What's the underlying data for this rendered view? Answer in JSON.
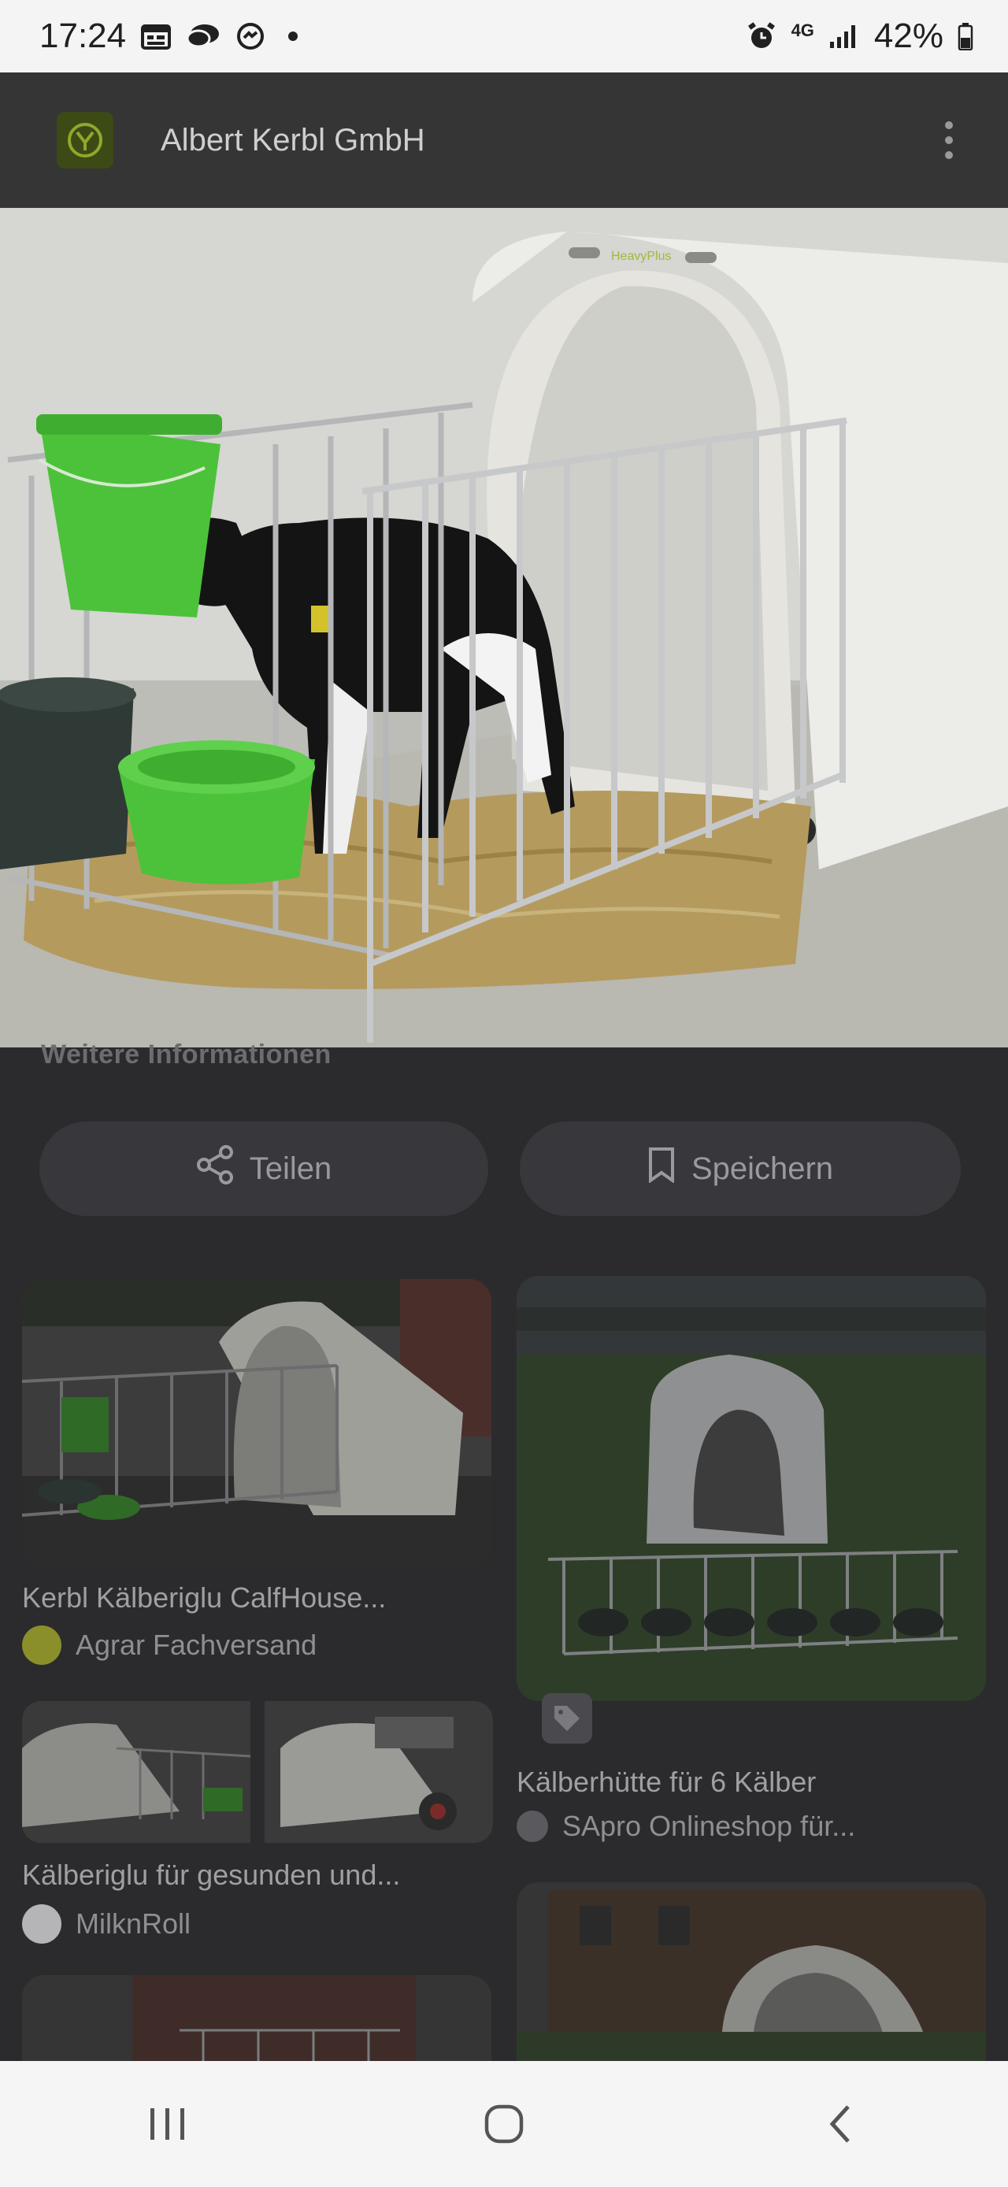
{
  "status_bar": {
    "time": "17:24",
    "network": "4G",
    "battery": "42%"
  },
  "header": {
    "title": "Albert Kerbl GmbH",
    "logo_icon": "kerbl-logo-icon",
    "menu_icon": "more-vert-icon"
  },
  "hero": {
    "product_label": "HeavyPlus"
  },
  "section": {
    "more_info": "Weitere Informationen"
  },
  "actions": {
    "share_label": "Teilen",
    "save_label": "Speichern"
  },
  "results": [
    {
      "title": "Kerbl Kälberiglu CalfHouse...",
      "source": "Agrar Fachversand"
    },
    {
      "title": "Kälberhütte für 6 Kälber",
      "source": "SApro Onlineshop für..."
    },
    {
      "title": "Kälberiglu für gesunden und...",
      "source": "MilknRoll"
    }
  ],
  "colors": {
    "accent_green": "#4cc23a",
    "header_bg": "#353535",
    "page_bg": "#2b2b2e"
  }
}
